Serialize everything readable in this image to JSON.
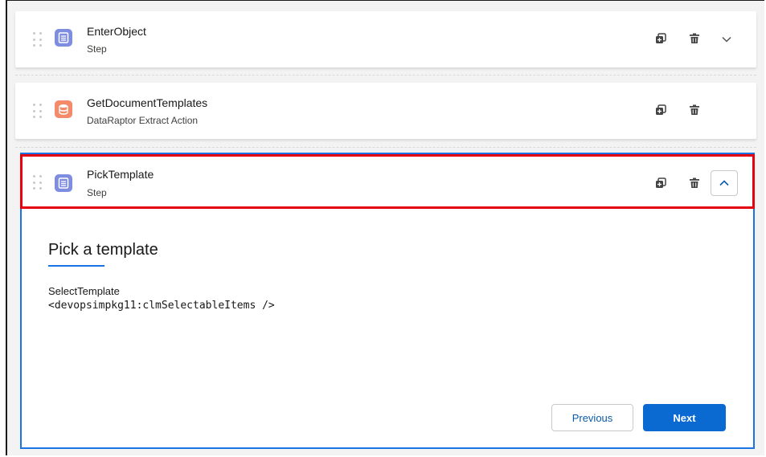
{
  "steps": [
    {
      "title": "EnterObject",
      "subtitle": "Step",
      "icon": "step-icon",
      "color": "#7f8de1"
    },
    {
      "title": "GetDocumentTemplates",
      "subtitle": "DataRaptor Extract Action",
      "icon": "dataraptor-icon",
      "color": "#f38a69"
    },
    {
      "title": "PickTemplate",
      "subtitle": "Step",
      "icon": "step-icon",
      "color": "#7f8de1"
    }
  ],
  "expanded": {
    "heading": "Pick a template",
    "field_label": "SelectTemplate",
    "field_code": "<devopsimpkg11:clmSelectableItems />"
  },
  "buttons": {
    "previous": "Previous",
    "next": "Next"
  },
  "colors": {
    "accent": "#1b74e4",
    "highlight": "#e3000f",
    "next_button": "#0b6ad1"
  }
}
